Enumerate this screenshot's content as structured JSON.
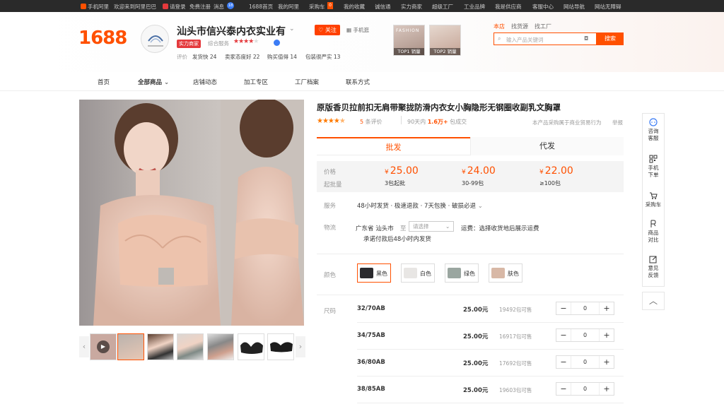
{
  "topbar": {
    "mobile": "手机阿里",
    "welcome": "欢迎来到阿里巴巴",
    "login": "请登录",
    "register": "免费注册",
    "messages": "消息",
    "msg_count": "18",
    "links": [
      "1688首页",
      "我的阿里",
      "采购车",
      "我的收藏",
      "诚信通",
      "实力商家",
      "超级工厂",
      "工业品牌",
      "我是供应商",
      "客服中心",
      "网站导航",
      "网站无障碍"
    ],
    "cart_count": "0"
  },
  "header": {
    "logo": "1688",
    "shop_name": "汕头市信兴泰内衣实业有",
    "shop_badge": "实力商家",
    "overall_label": "综合服务",
    "follow_label": "关注",
    "mobile_shop": "手机逛",
    "ratings": [
      {
        "label": "评价",
        "value": ""
      },
      {
        "label": "发货快",
        "value": "24"
      },
      {
        "label": "卖家态度好",
        "value": "22"
      },
      {
        "label": "购买值得",
        "value": "14"
      },
      {
        "label": "包装很严实",
        "value": "13"
      }
    ],
    "promos": [
      {
        "label": "TOP1 销量",
        "sub": "FASHION"
      },
      {
        "label": "TOP2 销量",
        "sub": ""
      }
    ],
    "search_tabs": [
      "本店",
      "找货源",
      "找工厂"
    ],
    "search_placeholder": "输入产品关键词",
    "search_button": "搜索"
  },
  "nav": {
    "items": [
      "首页",
      "全部商品",
      "店铺动态",
      "加工专区",
      "工厂档案",
      "联系方式"
    ]
  },
  "product": {
    "title": "原版香贝拉前扣无肩带聚拢防滑内衣女小胸隐形无钢圈收副乳文胸罩",
    "review_count": "5",
    "review_label": "条评价",
    "sales_prefix": "90天内",
    "sales_value": "1.6万+",
    "sales_suffix": "包成交",
    "notice": "本产品采购属于商业贸易行为",
    "report": "举报",
    "tab_wholesale": "批发",
    "tab_dropship": "代发",
    "price_label": "价格",
    "qty_label": "起批量",
    "prices": [
      {
        "symbol": "¥",
        "value": "25.00",
        "qty": "3包起批"
      },
      {
        "symbol": "¥",
        "value": "24.00",
        "qty": "30-99包"
      },
      {
        "symbol": "¥",
        "value": "22.00",
        "qty": "≥100包"
      }
    ],
    "service_label": "服务",
    "service_text": "48小时发货 · 极速退款 · 7天包换 · 破损必退",
    "logistics_label": "物流",
    "logistics_from": "广东省 汕头市",
    "logistics_to": "至",
    "logistics_select": "请选择",
    "logistics_fee": "运费：选择收货地后展示运费",
    "logistics_promise": "承诺付款后48小时内发货",
    "color_label": "颜色",
    "colors": [
      {
        "name": "黑色",
        "swatch": "#2a2a2e"
      },
      {
        "name": "白色",
        "swatch": "#e8e6e4"
      },
      {
        "name": "绿色",
        "swatch": "#9aa6a0"
      },
      {
        "name": "肤色",
        "swatch": "#d8b8a6"
      }
    ],
    "size_label": "尺码",
    "sizes": [
      {
        "size": "32/70AB",
        "price": "25.00元",
        "stock": "19492包可售",
        "qty": "0"
      },
      {
        "size": "34/75AB",
        "price": "25.00元",
        "stock": "16917包可售",
        "qty": "0"
      },
      {
        "size": "36/80AB",
        "price": "25.00元",
        "stock": "17692包可售",
        "qty": "0"
      },
      {
        "size": "38/85AB",
        "price": "25.00元",
        "stock": "19603包可售",
        "qty": "0"
      }
    ]
  },
  "rail": {
    "items": [
      "咨询客服",
      "手机下单",
      "采购车",
      "商品对比",
      "意见反馈"
    ]
  },
  "colors": {
    "accent": "#ff5000",
    "topbar": "#2a2a2a"
  }
}
